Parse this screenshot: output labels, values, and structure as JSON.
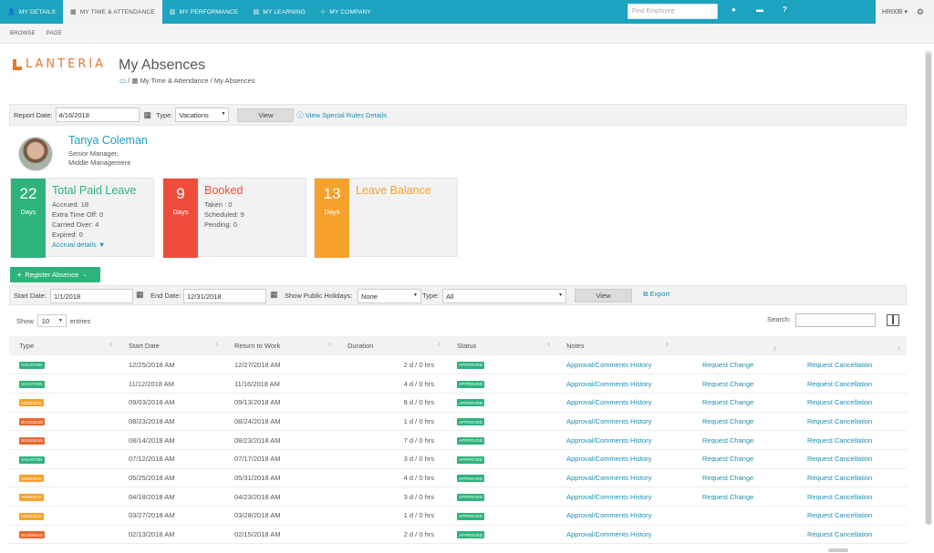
{
  "topnav": {
    "tabs": [
      {
        "label": "MY DETAILS",
        "icon": "user-icon"
      },
      {
        "label": "MY TIME & ATTENDANCE",
        "icon": "calendar-icon"
      },
      {
        "label": "MY PERFORMANCE",
        "icon": "chart-icon"
      },
      {
        "label": "MY LEARNING",
        "icon": "book-icon"
      },
      {
        "label": "MY COMPANY",
        "icon": "org-icon"
      }
    ],
    "find_placeholder": "Find Employee",
    "user": "HR00B ▾"
  },
  "subbar": {
    "items": [
      "BROWSE",
      "PAGE"
    ]
  },
  "logo_text": "LANTERIA",
  "page_title": "My Absences",
  "breadcrumb": {
    "item1": "My Time & Attendance",
    "item2": "My Absences",
    "sep": "/"
  },
  "filter": {
    "report_date_label": "Report Date:",
    "report_date": "4/16/2018",
    "type_label": "Type:",
    "type_value": "Vacations",
    "view_label": "View",
    "special_rules": "View Special Rules Details"
  },
  "employee": {
    "name": "Tanya Coleman",
    "title": "Senior Manager,",
    "dept": "Middle Management"
  },
  "cards": {
    "paid": {
      "num": "22",
      "unit": "Days",
      "title": "Total Paid Leave",
      "accrued": "Accrued: 18",
      "extra": "Extra Time Off: 0",
      "carried": "Carried Over: 4",
      "expired": "Expired: 0",
      "accrual_link": "Accrual details ▼",
      "color": "#2eb37c"
    },
    "booked": {
      "num": "9",
      "unit": "Days",
      "title": "Booked",
      "taken": "Taken : 0",
      "scheduled": "Scheduled: 9",
      "pending": "Pending: 0",
      "color": "#ef4d3c"
    },
    "balance": {
      "num": "13",
      "unit": "Days",
      "title": "Leave Balance",
      "color": "#f6a12b"
    }
  },
  "register_label": "Register Absence",
  "filter2": {
    "start_label": "Start Date:",
    "start": "1/1/2018",
    "end_label": "End Date:",
    "end": "12/31/2018",
    "holidays_label": "Show Public Holidays:",
    "holidays": "None",
    "type_label": "Type:",
    "type": "All",
    "view_label": "View",
    "export_label": "Export"
  },
  "list": {
    "show_label": "Show",
    "entries": "10",
    "entries_label": "entries",
    "search_label": "Search:"
  },
  "table": {
    "headers": [
      "Type",
      "Start Date",
      "Return to Work",
      "Duration",
      "Status",
      "Notes",
      "",
      ""
    ],
    "history_label": "Approval/Comments History",
    "change_label": "Request Change",
    "cancel_label": "Request Cancellation",
    "rows": [
      {
        "type": "VACATION",
        "color": "#2eb37c",
        "start": "12/25/2018 AM",
        "ret": "12/27/2018 AM",
        "dur": "2 d / 0 hrs",
        "status": "APPROVED",
        "change": true
      },
      {
        "type": "VACATION",
        "color": "#2eb37c",
        "start": "11/12/2018 AM",
        "ret": "11/16/2018 AM",
        "dur": "4 d / 0 hrs",
        "status": "APPROVED",
        "change": true
      },
      {
        "type": "ABSENCE",
        "color": "#f6a12b",
        "start": "09/03/2018 AM",
        "ret": "09/13/2018 AM",
        "dur": "8 d / 0 hrs",
        "status": "APPROVED",
        "change": true
      },
      {
        "type": "SICKNESS",
        "color": "#e8672e",
        "start": "08/23/2018 AM",
        "ret": "08/24/2018 AM",
        "dur": "1 d / 0 hrs",
        "status": "APPROVED",
        "change": true
      },
      {
        "type": "SICKNESS",
        "color": "#e8672e",
        "start": "08/14/2018 AM",
        "ret": "08/23/2018 AM",
        "dur": "7 d / 0 hrs",
        "status": "APPROVED",
        "change": true
      },
      {
        "type": "VACATION",
        "color": "#2eb37c",
        "start": "07/12/2018 AM",
        "ret": "07/17/2018 AM",
        "dur": "3 d / 0 hrs",
        "status": "APPROVED",
        "change": true
      },
      {
        "type": "ABSENCE",
        "color": "#f6a12b",
        "start": "05/25/2018 AM",
        "ret": "05/31/2018 AM",
        "dur": "4 d / 0 hrs",
        "status": "APPROVED",
        "change": true
      },
      {
        "type": "ABSENCE",
        "color": "#f6a12b",
        "start": "04/18/2018 AM",
        "ret": "04/23/2018 AM",
        "dur": "3 d / 0 hrs",
        "status": "APPROVED",
        "change": true
      },
      {
        "type": "ABSENCE",
        "color": "#f6a12b",
        "start": "03/27/2018 AM",
        "ret": "03/28/2018 AM",
        "dur": "1 d / 0 hrs",
        "status": "APPROVED",
        "change": false
      },
      {
        "type": "SICKNESS",
        "color": "#e8672e",
        "start": "02/13/2018 AM",
        "ret": "02/15/2018 AM",
        "dur": "2 d / 0 hrs",
        "status": "APPROVED",
        "change": false
      }
    ]
  },
  "colors": {
    "accent": "#1ba3bf",
    "approved": "#2eb37c",
    "link": "#1a8fb0"
  }
}
